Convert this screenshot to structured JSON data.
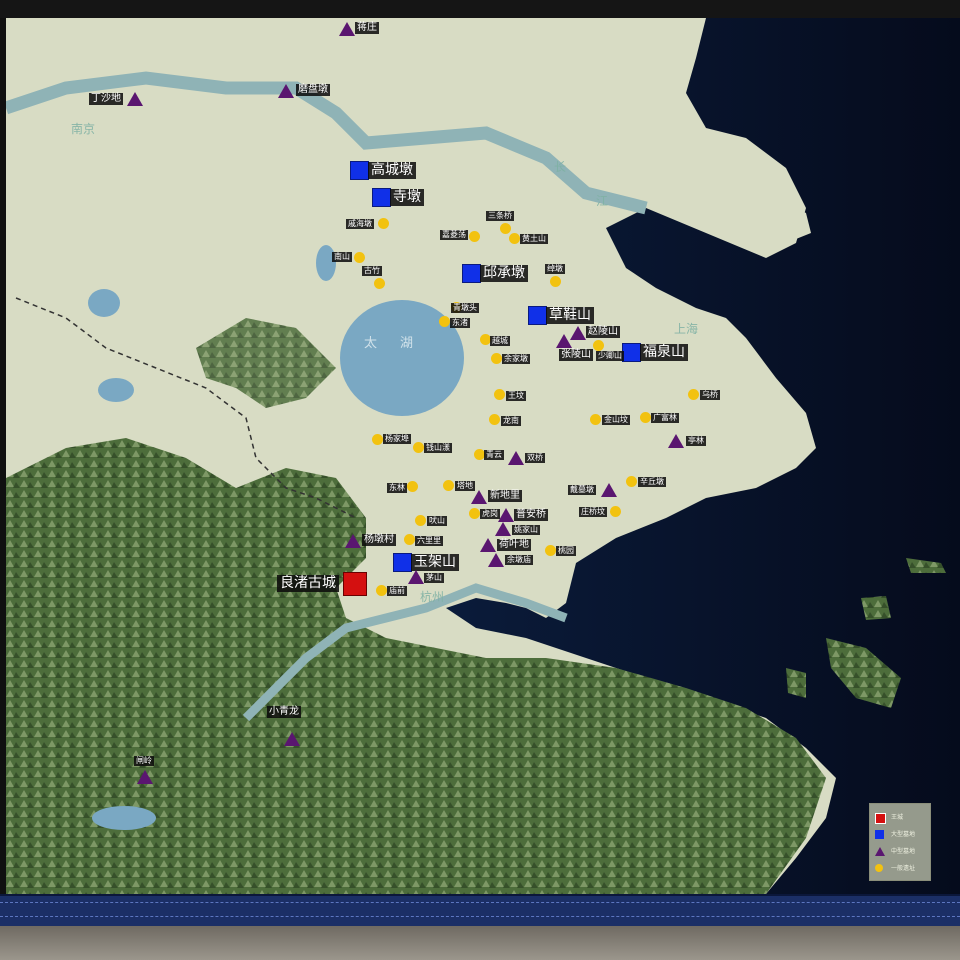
{
  "map": {
    "geo_labels": {
      "nanjing": "南京",
      "changjiang_1": "长",
      "changjiang_2": "江",
      "taihu_1": "太",
      "taihu_2": "湖",
      "shanghai": "上海",
      "hangzhou": "杭州"
    },
    "sites": {
      "liangzhu": "良渚古城",
      "gaochengdun": "高城墩",
      "sidun": "寺墩",
      "qiuchengdun": "邱承墩",
      "caoxieshan": "草鞋山",
      "fuquanshan": "福泉山",
      "yujiashan": "玉架山",
      "jiangzhuang": "蒋庄",
      "dingshadi": "丁沙地",
      "mopandun": "磨盘墩",
      "zhaolingshan": "赵陵山",
      "zhanglingshan": "张陵山",
      "shaoqingshan": "少卿山",
      "tinglin": "亭林",
      "shuangqiao": "双桥",
      "daijiadun": "戴墓墩",
      "xindili": "新地里",
      "puanqiao": "普安桥",
      "yaojiashan": "姚家山",
      "heyedi": "荷叶地",
      "yuduimiao": "余墩庙",
      "yangdunchun": "杨墩村",
      "maoshan": "茅山",
      "xiaoqinglong": "小青龙",
      "zhaling": "闸岭",
      "chenghai_dun": "戚海墩",
      "sanchaqiao": "三条桥",
      "jiaqi_lu": "嘉菱荡",
      "huangtushan": "黄土山",
      "nanshan": "南山",
      "gu_zhu": "古竹",
      "chandun": "绰墩",
      "qingdui_tou": "青墩头",
      "dongzhu": "东渚",
      "yue_cheng": "越城",
      "yu_jia_dun": "余家墩",
      "wang_fen": "王坟",
      "long_nan": "龙南",
      "jinshan_fen": "金山坟",
      "guang_fu_lin": "广富林",
      "wu_qiao": "乌桥",
      "yang_jia_bu": "杨家埠",
      "qian_shan_yang": "钱山漾",
      "qing_yun": "青云",
      "dong_lin": "东林",
      "ta_di": "塔地",
      "xin_qiu_dun": "辛丘墩",
      "hu_gang": "虎岗",
      "zhuang_qiao_fen": "庄桥坟",
      "fei_shan": "吠山",
      "liu_ge_li": "六里里",
      "tao_yuan": "桃园",
      "miao_qian": "庙前"
    }
  },
  "legend": {
    "items": [
      {
        "icon": "red-square",
        "color": "#d41010",
        "label": "王城"
      },
      {
        "icon": "blue-square",
        "color": "#1030e8",
        "label": "大型墓地"
      },
      {
        "icon": "purple-triangle",
        "color": "#5a1670",
        "label": "中型墓地"
      },
      {
        "icon": "yellow-dot",
        "color": "#f2c210",
        "label": "一般遗址"
      }
    ]
  },
  "colors": {
    "land": "#d7dcc3",
    "mountain": "#4e6e3c",
    "sea": "#0b1c3a",
    "river": "#8fb3b6",
    "red_marker": "#d41010",
    "blue_marker": "#1030e8",
    "purple_marker": "#5a1670",
    "yellow_marker": "#f2c210"
  }
}
